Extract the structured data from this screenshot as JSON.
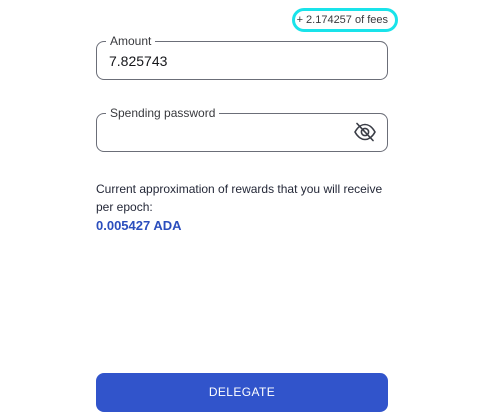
{
  "fees": {
    "text": "+ 2.174257 of fees"
  },
  "amount": {
    "label": "Amount",
    "value": "7.825743"
  },
  "spending_password": {
    "label": "Spending password",
    "value": "",
    "toggle_icon": "eye-slash-icon"
  },
  "rewards": {
    "caption": "Current approximation of rewards that you will receive per epoch:",
    "value": "0.005427 ADA",
    "value_color": "#2b4ebd"
  },
  "actions": {
    "delegate_label": "DELEGATE",
    "delegate_color": "#3154cb"
  },
  "highlight_color": "#19e3ea"
}
